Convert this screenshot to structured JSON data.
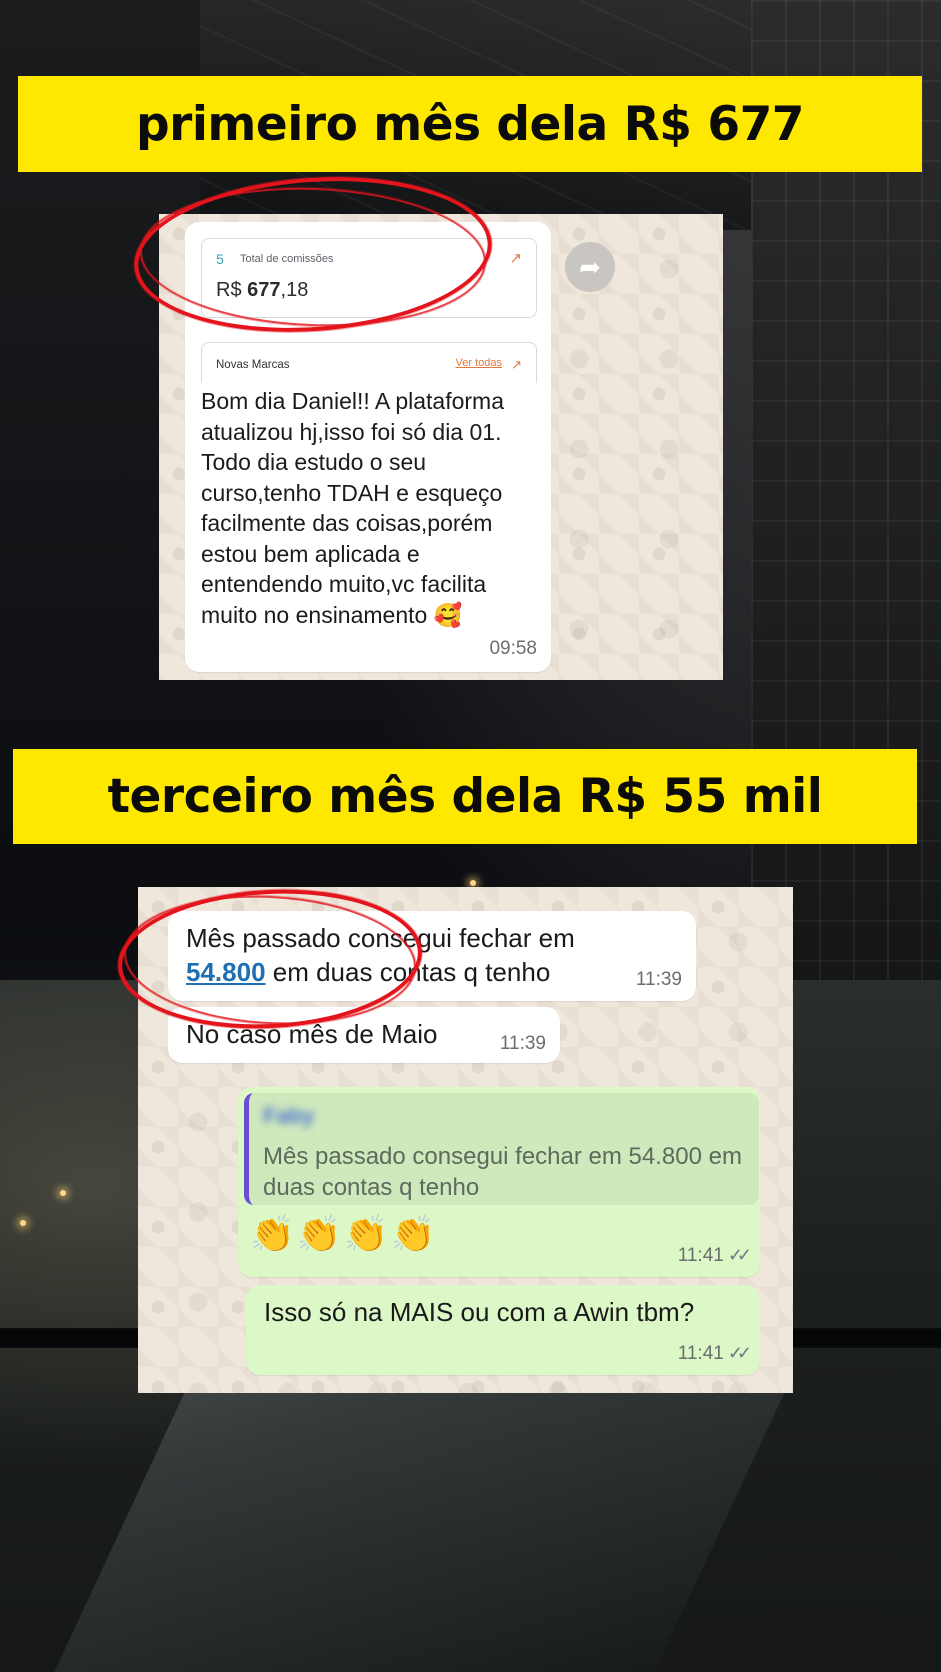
{
  "banners": {
    "first": "primeiro mês dela R$ 677",
    "third": "terceiro mês dela R$ 55 mil"
  },
  "chat1": {
    "commissions_card": {
      "icon": "5",
      "title": "Total de comissões",
      "currency": "R$",
      "amount_bold": "677",
      "amount_cents": ",18"
    },
    "brands_card": {
      "title": "Novas Marcas",
      "link": "Ver todas"
    },
    "message": "Bom dia Daniel!! A plataforma atualizou hj,isso foi só dia 01. Todo dia estudo o seu curso,tenho TDAH e esqueço facilmente das coisas,porém estou bem aplicada e entendendo muito,vc facilita muito no ensinamento 🥰",
    "time": "09:58",
    "forward_icon": "forward-icon"
  },
  "chat2": {
    "messages": [
      {
        "text_line1": "Mês passado consegui fechar em",
        "link": "54.800",
        "text_line2_rest": " em duas contas q tenho",
        "time": "11:39"
      },
      {
        "text": "No caso mês de Maio",
        "time": "11:39"
      },
      {
        "quote_author": "Faby",
        "quote_text": "Mês passado consegui fechar em 54.800 em duas contas q tenho",
        "emoji": "👏👏👏👏",
        "time": "11:41",
        "ticks": "✓✓"
      },
      {
        "text": "Isso só na MAIS ou com a Awin tbm?",
        "time": "11:41",
        "ticks": "✓✓"
      }
    ]
  },
  "colors": {
    "banner": "#ffe800",
    "highlight_ring": "#e3141b",
    "outgoing_bubble": "#dcf8c6",
    "chat_wallpaper": "#efe7dc"
  }
}
